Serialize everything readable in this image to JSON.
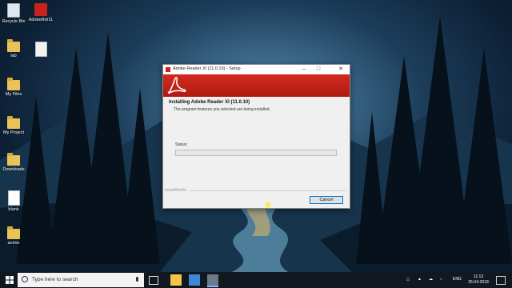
{
  "desktop_icons": [
    {
      "label": "Recycle Bin",
      "icon": "recycle-bin-icon"
    },
    {
      "label": "AdobeRdr11",
      "icon": "adobe-installer-icon"
    },
    {
      "label": "lab",
      "icon": "folder-icon"
    },
    {
      "label": "",
      "icon": "document-icon"
    },
    {
      "label": "My Files",
      "icon": "folder-icon"
    },
    {
      "label": "My Project",
      "icon": "folder-icon"
    },
    {
      "label": "Downloads",
      "icon": "folder-icon"
    },
    {
      "label": "blank",
      "icon": "edge-file-icon"
    },
    {
      "label": "anime",
      "icon": "folder-icon"
    }
  ],
  "installer": {
    "title": "Adobe Reader XI (11.0.10) - Setup",
    "heading": "Installing Adobe Reader XI (11.0.10)",
    "subtitle": "The program features you selected are being installed.",
    "status_label": "Status:",
    "progress": 0,
    "brand": "InstallShield",
    "cancel_label": "Cancel",
    "accent_color": "#c8221c"
  },
  "taskbar": {
    "search_placeholder": "Type here to search",
    "tray_lang": "ENG",
    "time": "11:13",
    "date": "25-04-2018"
  }
}
